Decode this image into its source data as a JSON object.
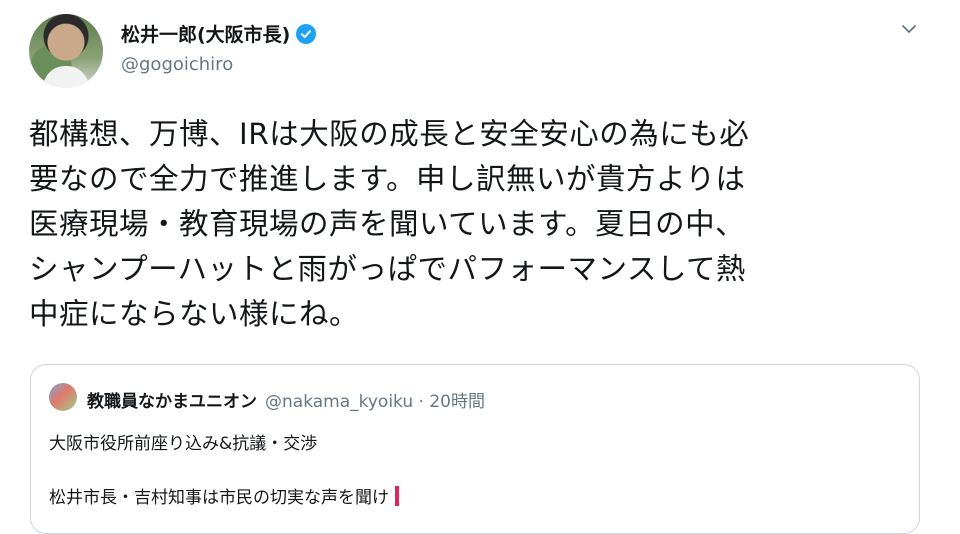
{
  "user": {
    "display_name": "松井一郎(大阪市長)",
    "handle": "@gogoichiro"
  },
  "tweet": {
    "lines": [
      "都構想、万博、IRは大阪の成長と安全安心の為にも必",
      "要なので全力で推進します。申し訳無いが貴方よりは",
      "医療現場・教育現場の声を聞いています。夏日の中、",
      "シャンプーハットと雨がっぱでパフォーマンスして熱",
      "中症にならない様にね。"
    ]
  },
  "quote": {
    "name": "教職員なかまユニオン",
    "meta": "@nakama_kyoiku · 20時間",
    "line1": "大阪市役所前座り込み&抗議・交渉",
    "line2": "松井市長・吉村知事は市民の切実な声を聞け"
  },
  "colors": {
    "verified": "#1da1f2",
    "muted": "#657786",
    "border": "#ccd6dd"
  },
  "icons": {
    "verified": "verified-badge-icon",
    "menu": "chevron-down-icon"
  }
}
